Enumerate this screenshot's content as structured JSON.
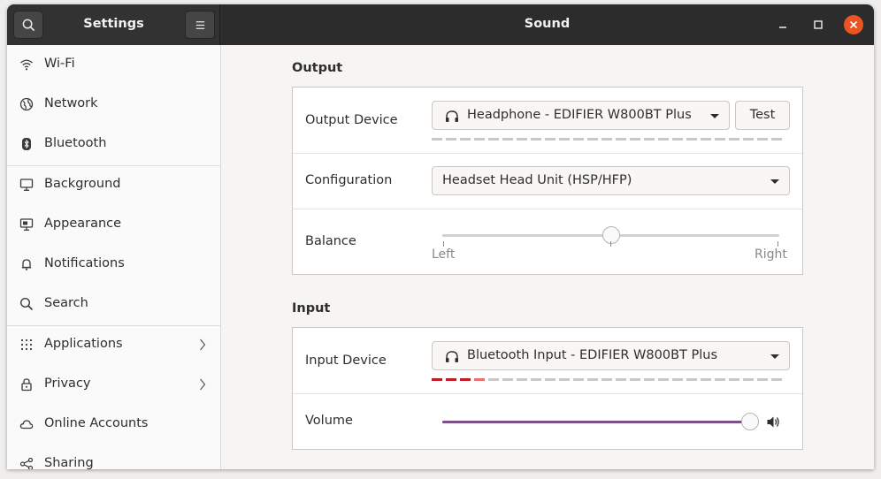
{
  "header": {
    "sidebar_title": "Settings",
    "page_title": "Sound",
    "icons": [
      "search-icon",
      "hamburger-menu-icon",
      "minimize-icon",
      "maximize-icon",
      "close-icon"
    ],
    "close_color": "#e95420"
  },
  "sidebar": {
    "items": [
      {
        "label": "Wi-Fi",
        "icon": "wifi-icon"
      },
      {
        "label": "Network",
        "icon": "network-globe-icon"
      },
      {
        "label": "Bluetooth",
        "icon": "bluetooth-icon"
      },
      {
        "label": "Background",
        "icon": "monitor-icon"
      },
      {
        "label": "Appearance",
        "icon": "appearance-icon"
      },
      {
        "label": "Notifications",
        "icon": "bell-icon"
      },
      {
        "label": "Search",
        "icon": "search-icon"
      },
      {
        "label": "Applications",
        "icon": "apps-grid-icon",
        "has_submenu": true
      },
      {
        "label": "Privacy",
        "icon": "lock-icon",
        "has_submenu": true
      },
      {
        "label": "Online Accounts",
        "icon": "cloud-icon"
      },
      {
        "label": "Sharing",
        "icon": "share-icon"
      }
    ]
  },
  "output": {
    "title": "Output",
    "device_label": "Output Device",
    "device_value": "Headphone - EDIFIER W800BT Plus",
    "test_label": "Test",
    "config_label": "Configuration",
    "config_value": "Headset Head Unit (HSP/HFP)",
    "balance_label": "Balance",
    "balance_left": "Left",
    "balance_right": "Right",
    "balance_value": 0.5
  },
  "input": {
    "title": "Input",
    "device_label": "Input Device",
    "device_value": "Bluetooth Input - EDIFIER W800BT Plus",
    "level_segments_active": 3.5,
    "volume_label": "Volume",
    "volume_value": 1.0,
    "accent_color": "#7d4f89",
    "level_color": "#c01c28"
  }
}
